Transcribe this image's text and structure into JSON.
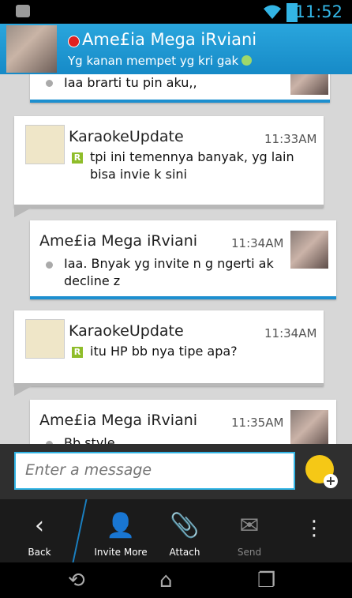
{
  "status_bar": {
    "time": "11:52"
  },
  "header": {
    "contact_name": "Ame£ia Mega iRviani",
    "status_message": "Yg kanan mempet yg kri gak"
  },
  "messages": [
    {
      "sender": "",
      "time": "",
      "text": "Iaa brarti tu pin aku,,",
      "side": "mine"
    },
    {
      "sender": "KaraokeUpdate",
      "time": "11:33AM",
      "text": "tpi ini temennya banyak, yg lain bisa invie k sini",
      "side": "theirs"
    },
    {
      "sender": "Ame£ia Mega iRviani",
      "time": "11:34AM",
      "text": "Iaa.  Bnyak yg invite n g ngerti ak decline z",
      "side": "mine"
    },
    {
      "sender": "KaraokeUpdate",
      "time": "11:34AM",
      "text": "itu HP bb nya tipe apa?",
      "side": "theirs"
    },
    {
      "sender": "Ame£ia Mega iRviani",
      "time": "11:35AM",
      "text": "Bb style",
      "side": "mine"
    }
  ],
  "input": {
    "placeholder": "Enter a message"
  },
  "toolbar": {
    "back": "Back",
    "invite_more": "Invite More",
    "attach": "Attach",
    "send": "Send"
  },
  "colors": {
    "accent": "#33b5e5",
    "header_blue": "#1d8fcf"
  }
}
